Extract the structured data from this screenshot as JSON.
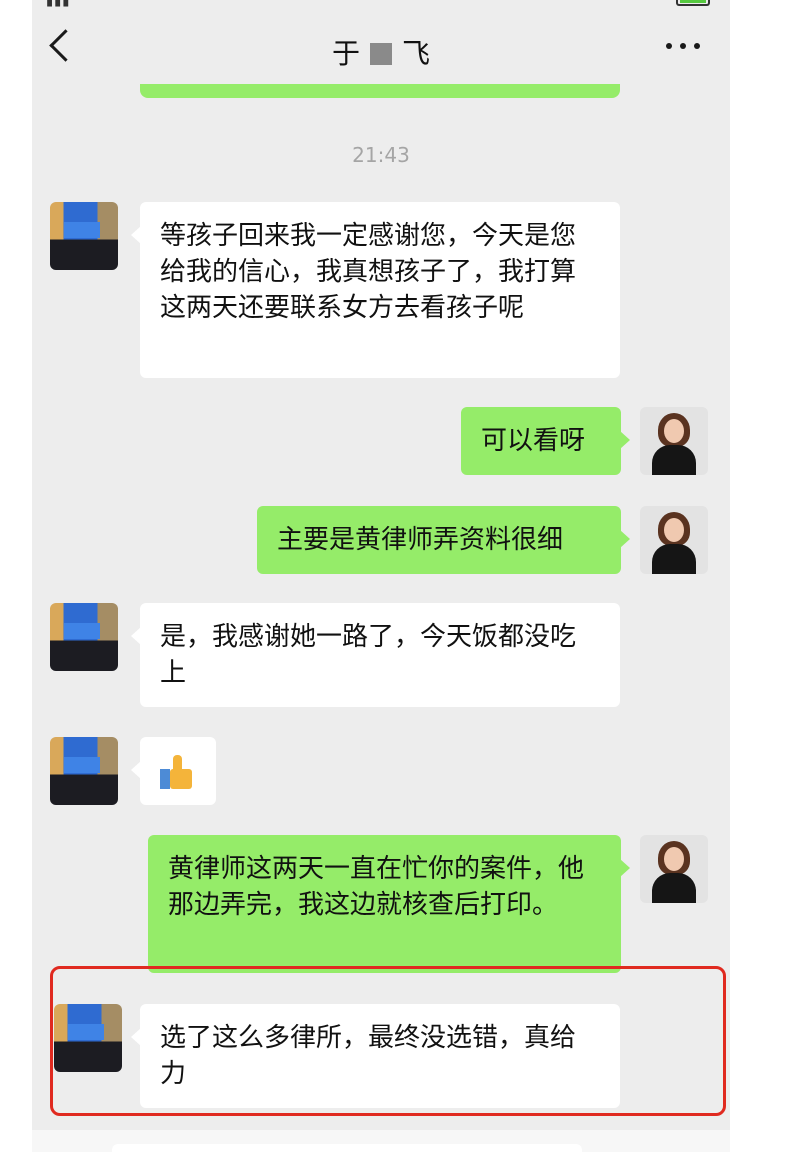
{
  "header": {
    "title_left": "于",
    "title_right": "飞",
    "back_icon": "chevron-left-icon",
    "more_icon": "more-dots-icon"
  },
  "timestamp": "21:43",
  "colors": {
    "background": "#ededed",
    "outgoing_bubble": "#95ec69",
    "incoming_bubble": "#ffffff",
    "highlight": "#e02a20"
  },
  "messages": [
    {
      "from": "client",
      "text": "等孩子回来我一定感谢您，今天是您给我的信心，我真想孩子了，我打算这两天还要联系女方去看孩子呢"
    },
    {
      "from": "lawyer",
      "text": "可以看呀"
    },
    {
      "from": "lawyer",
      "text": "主要是黄律师弄资料很细"
    },
    {
      "from": "client",
      "text": "是，我感谢她一路了，今天饭都没吃上"
    },
    {
      "from": "client",
      "text": "",
      "sticker": "thumbs-up-icon"
    },
    {
      "from": "lawyer",
      "text": "黄律师这两天一直在忙你的案件，他那边弄完，我这边就核查后打印。"
    },
    {
      "from": "client",
      "text": "选了这么多律所，最终没选错，真给力",
      "highlighted": true
    }
  ]
}
